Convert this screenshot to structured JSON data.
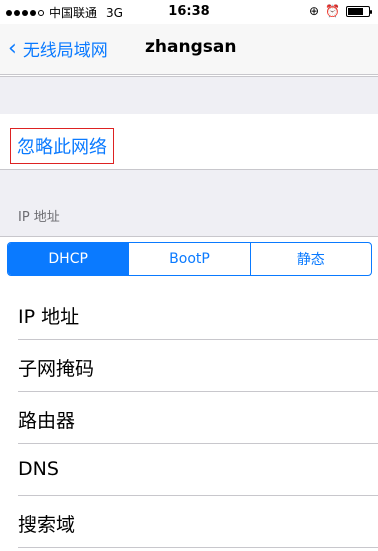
{
  "status_bar": {
    "carrier": "中国联通",
    "network": "3G",
    "time": "16:38"
  },
  "nav": {
    "back_label": "无线局域网",
    "title": "zhangsan"
  },
  "forget_label": "忽略此网络",
  "section_label": "IP 地址",
  "segments": [
    {
      "label": "DHCP",
      "selected": true
    },
    {
      "label": "BootP",
      "selected": false
    },
    {
      "label": "静态",
      "selected": false
    }
  ],
  "rows": [
    {
      "label": "IP 地址"
    },
    {
      "label": "子网掩码"
    },
    {
      "label": "路由器"
    },
    {
      "label": "DNS"
    },
    {
      "label": "搜索域"
    }
  ]
}
